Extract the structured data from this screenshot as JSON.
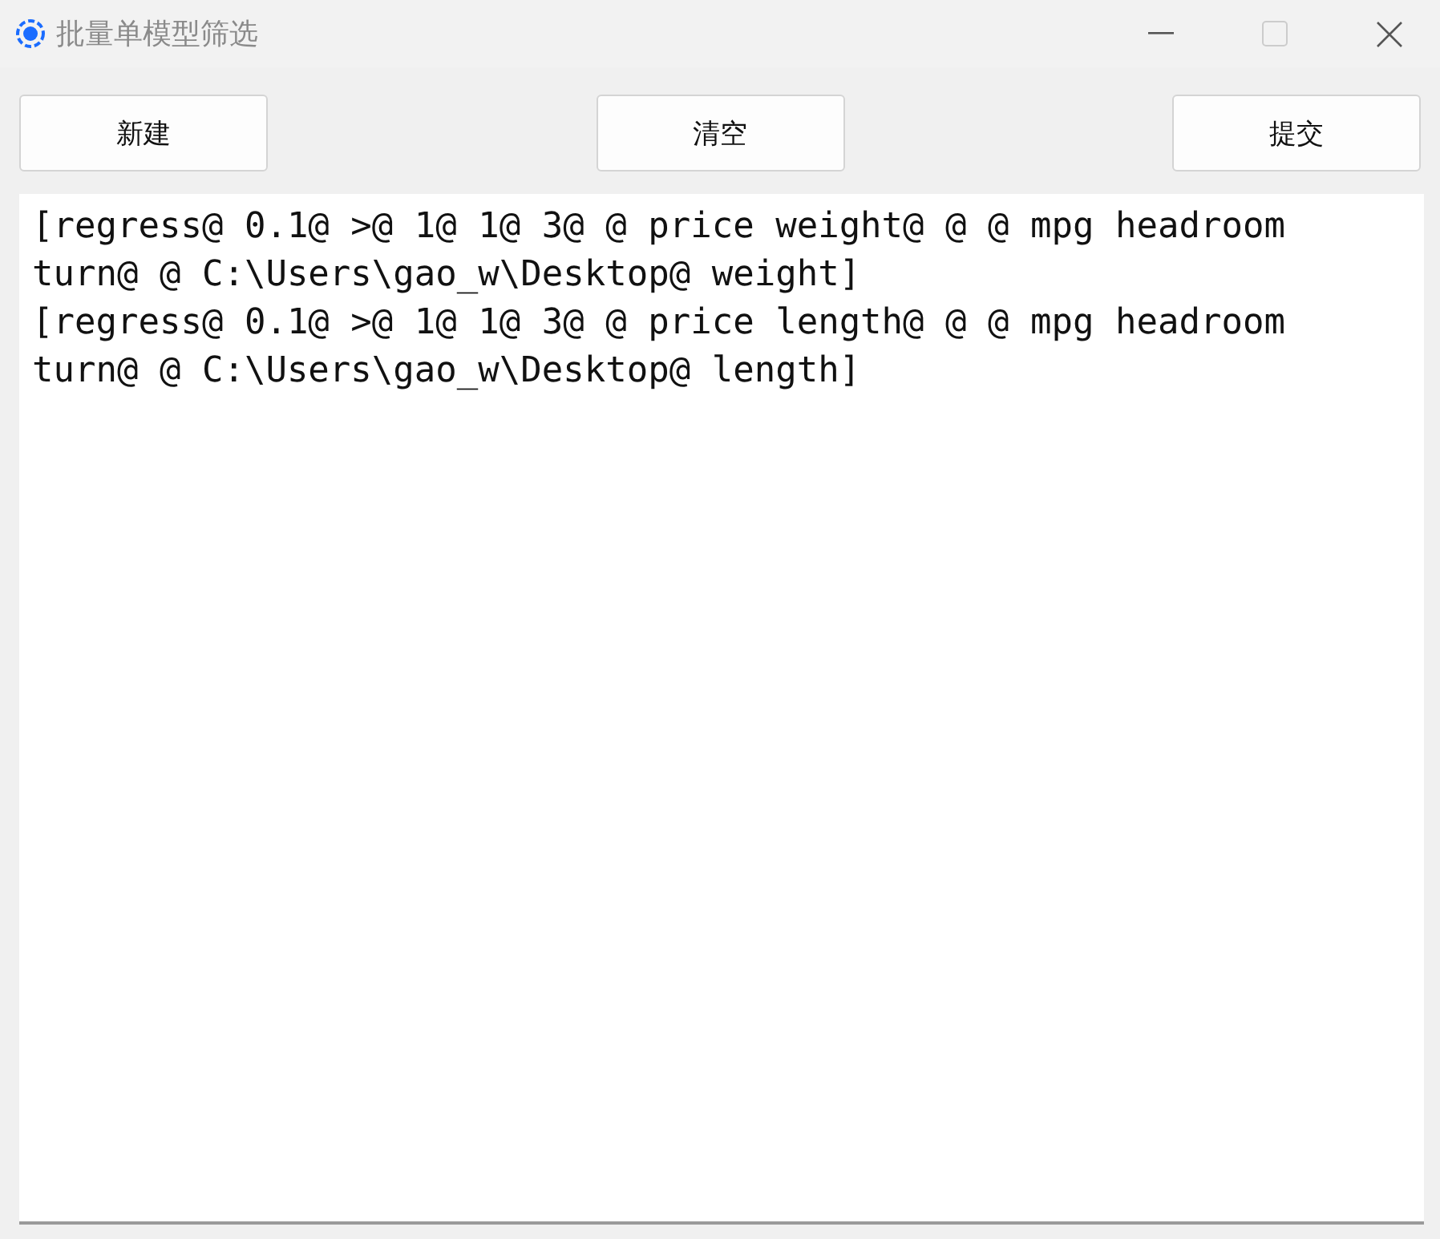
{
  "window": {
    "title": "批量单模型筛选"
  },
  "buttons": [
    "新建",
    "清空",
    "提交"
  ],
  "text_area": {
    "lines": [
      "[regress@ 0.1@ >@ 1@ 1@ 3@ @ price weight@ @ @ mpg headroom",
      "turn@ @ C:\\Users\\gao_w\\Desktop@ weight]",
      "[regress@ 0.1@ >@ 1@ 1@ 3@ @ price length@ @ @ mpg headroom",
      "turn@ @ C:\\Users\\gao_w\\Desktop@ length]"
    ]
  }
}
